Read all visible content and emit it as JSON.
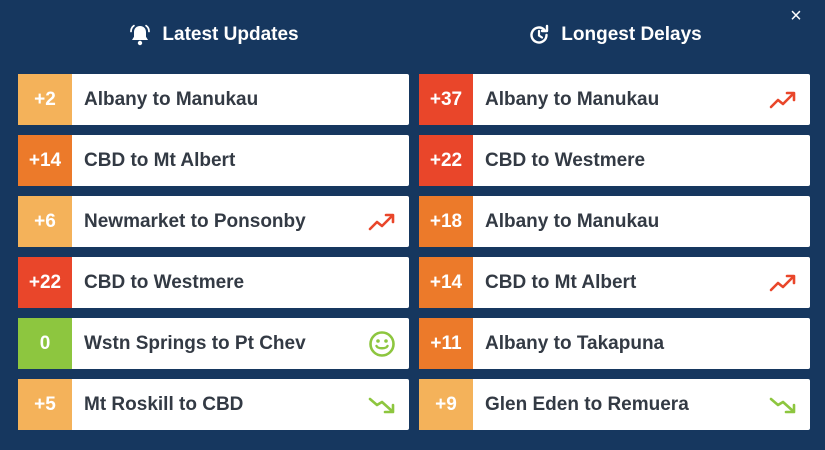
{
  "latest": {
    "title": "Latest Updates",
    "icon": "bell-icon",
    "rows": [
      {
        "delay": "+2",
        "route": "Albany to Manukau",
        "color": "#f4b25a",
        "trend": ""
      },
      {
        "delay": "+14",
        "route": "CBD to Mt Albert",
        "color": "#ec7a2a",
        "trend": ""
      },
      {
        "delay": "+6",
        "route": "Newmarket to Ponsonby",
        "color": "#f4b25a",
        "trend": "up"
      },
      {
        "delay": "+22",
        "route": "CBD to Westmere",
        "color": "#e9462a",
        "trend": ""
      },
      {
        "delay": "0",
        "route": "Wstn Springs to Pt Chev",
        "color": "#8dc63f",
        "trend": "smile"
      },
      {
        "delay": "+5",
        "route": "Mt Roskill to CBD",
        "color": "#f4b25a",
        "trend": "down"
      }
    ]
  },
  "longest": {
    "title": "Longest Delays",
    "icon": "refresh-clock-icon",
    "rows": [
      {
        "delay": "+37",
        "route": "Albany to Manukau",
        "color": "#e9462a",
        "trend": "up"
      },
      {
        "delay": "+22",
        "route": "CBD to Westmere",
        "color": "#e9462a",
        "trend": ""
      },
      {
        "delay": "+18",
        "route": "Albany to Manukau",
        "color": "#ec7a2a",
        "trend": ""
      },
      {
        "delay": "+14",
        "route": "CBD to Mt Albert",
        "color": "#ec7a2a",
        "trend": "up"
      },
      {
        "delay": "+11",
        "route": "Albany to Takapuna",
        "color": "#ec7a2a",
        "trend": ""
      },
      {
        "delay": "+9",
        "route": "Glen Eden to Remuera",
        "color": "#f4b25a",
        "trend": "down"
      }
    ]
  },
  "close_label": "×"
}
